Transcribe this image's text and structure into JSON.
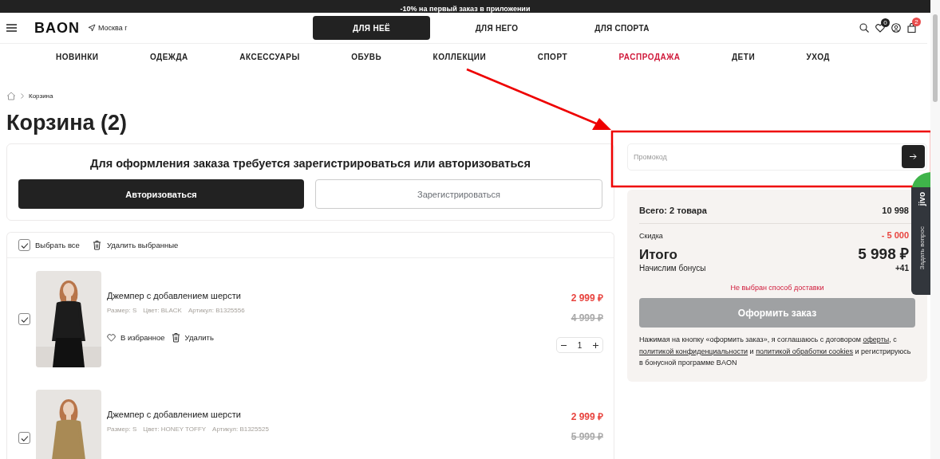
{
  "promo_banner": "-10% на первый заказ в приложении",
  "header": {
    "logo": "BAON",
    "city": "Москва г",
    "favorites_count": "0",
    "cart_count": "2",
    "tabs": [
      {
        "label": "ДЛЯ НЕЁ",
        "selected": true
      },
      {
        "label": "ДЛЯ НЕГО",
        "selected": false
      },
      {
        "label": "ДЛЯ СПОРТА",
        "selected": false
      }
    ]
  },
  "nav": [
    {
      "label": "НОВИНКИ",
      "highlighted": false
    },
    {
      "label": "ОДЕЖДА",
      "highlighted": false
    },
    {
      "label": "АКСЕССУАРЫ",
      "highlighted": false
    },
    {
      "label": "ОБУВЬ",
      "highlighted": false
    },
    {
      "label": "КОЛЛЕКЦИИ",
      "highlighted": false
    },
    {
      "label": "СПОРТ",
      "highlighted": false
    },
    {
      "label": "РАСПРОДАЖА",
      "highlighted": true
    },
    {
      "label": "ДЕТИ",
      "highlighted": false
    },
    {
      "label": "УХОД",
      "highlighted": false
    }
  ],
  "breadcrumb": [
    "Корзина"
  ],
  "title": "Корзина (2)",
  "auth": {
    "message": "Для оформления заказа требуется зарегистрироваться или авторизоваться",
    "login_button": "Авторизоваться",
    "register_button": "Зарегистрироваться"
  },
  "cart": {
    "select_all": {
      "label": "Выбрать все",
      "checked": true
    },
    "delete_selected": "Удалить выбранные",
    "items": [
      {
        "name": "Джемпер с добавлением шерсти",
        "size": "Размер: S",
        "color_text": "Цвет: BLACK",
        "sku": "Артикул: B1325556",
        "price": "2 999 ₽",
        "old_price": "4 999 ₽",
        "checked": true,
        "favorite_label": "В избранное",
        "delete_label": "Удалить",
        "quantity": "1"
      },
      {
        "name": "Джемпер с добавлением шерсти",
        "size": "Размер: S",
        "color_text": "Цвет: HONEY TOFFY",
        "sku": "Артикул: B1325525",
        "price": "2 999 ₽",
        "old_price": "5 999 ₽",
        "checked": true
      }
    ]
  },
  "promo": {
    "placeholder": "Промокод"
  },
  "summary": {
    "total_label": "Всего: 2 товара",
    "total_value": "10 998",
    "discount_label": "Скидка",
    "discount_value": "- 5 000",
    "grand_label": "Итого",
    "grand_value": "5 998 ₽",
    "bonus_label": "Начислим бонусы",
    "bonus_value": "+41",
    "error": "Не выбран способ доставки",
    "checkout_button": "Оформить заказ",
    "checkout_disabled": true,
    "legal": [
      {
        "kind": "text",
        "text": "Нажимая на кнопку «оформить заказ», я соглашаюсь с договором "
      },
      {
        "kind": "link",
        "text": "оферты"
      },
      {
        "kind": "text",
        "text": ", с "
      },
      {
        "kind": "link",
        "text": "политикой конфиденциальности"
      },
      {
        "kind": "text",
        "text": " и "
      },
      {
        "kind": "link",
        "text": "политикой обработки cookies"
      },
      {
        "kind": "text",
        "text": " и регистрируюсь в бонусной программе BAON"
      }
    ]
  },
  "chat_widget": {
    "logo": "jivo",
    "label": "Задать вопрос"
  }
}
